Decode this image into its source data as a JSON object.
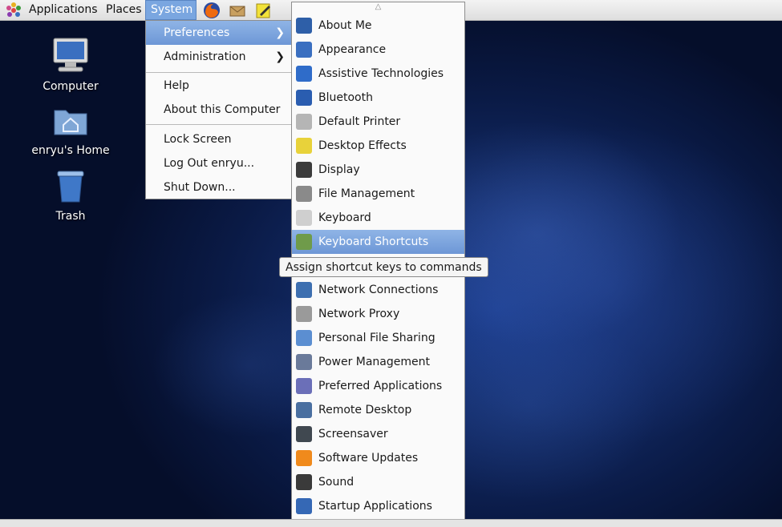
{
  "panel": {
    "applications": "Applications",
    "places": "Places",
    "system": "System",
    "launchers": [
      "firefox-icon",
      "mail-icon",
      "note-edit-icon"
    ]
  },
  "desktop_icons": [
    {
      "label": "Computer",
      "icon": "computer-icon"
    },
    {
      "label": "enryu's Home",
      "icon": "home-folder-icon"
    },
    {
      "label": "Trash",
      "icon": "trash-icon"
    }
  ],
  "system_menu": {
    "items": [
      {
        "label": "Preferences",
        "submenu": true
      },
      {
        "label": "Administration",
        "submenu": true
      },
      {
        "label": "Help"
      },
      {
        "label": "About this Computer"
      },
      {
        "label": "Lock Screen"
      },
      {
        "label": "Log Out enryu..."
      },
      {
        "label": "Shut Down..."
      }
    ],
    "highlighted": "Preferences"
  },
  "preferences_menu": {
    "items": [
      {
        "label": "About Me",
        "icon": "about-me-icon",
        "color": "#2e5fa8"
      },
      {
        "label": "Appearance",
        "icon": "appearance-icon",
        "color": "#3a6fc0"
      },
      {
        "label": "Assistive Technologies",
        "icon": "accessibility-icon",
        "color": "#2f6cc9"
      },
      {
        "label": "Bluetooth",
        "icon": "bluetooth-icon",
        "color": "#2a5db0"
      },
      {
        "label": "Default Printer",
        "icon": "printer-icon",
        "color": "#b5b5b5"
      },
      {
        "label": "Desktop Effects",
        "icon": "desktop-effects-icon",
        "color": "#e8d23a"
      },
      {
        "label": "Display",
        "icon": "display-icon",
        "color": "#3c3c3c"
      },
      {
        "label": "File Management",
        "icon": "file-management-icon",
        "color": "#8a8a8a"
      },
      {
        "label": "Keyboard",
        "icon": "keyboard-icon",
        "color": "#cfcfcf"
      },
      {
        "label": "Keyboard Shortcuts",
        "icon": "keyboard-shortcuts-icon",
        "color": "#6f9b4a"
      },
      {
        "label": "Network Connections",
        "icon": "network-connections-icon",
        "color": "#3d6fb0"
      },
      {
        "label": "Network Proxy",
        "icon": "network-proxy-icon",
        "color": "#9a9a9a"
      },
      {
        "label": "Personal File Sharing",
        "icon": "file-sharing-icon",
        "color": "#5b8ed1"
      },
      {
        "label": "Power Management",
        "icon": "power-management-icon",
        "color": "#6a7a9a"
      },
      {
        "label": "Preferred Applications",
        "icon": "preferred-apps-icon",
        "color": "#6b6fb8"
      },
      {
        "label": "Remote Desktop",
        "icon": "remote-desktop-icon",
        "color": "#4a6fa0"
      },
      {
        "label": "Screensaver",
        "icon": "screensaver-icon",
        "color": "#404850"
      },
      {
        "label": "Software Updates",
        "icon": "software-updates-icon",
        "color": "#f08a1c"
      },
      {
        "label": "Sound",
        "icon": "sound-icon",
        "color": "#3a3a3a"
      },
      {
        "label": "Startup Applications",
        "icon": "startup-apps-icon",
        "color": "#3568b5"
      }
    ],
    "highlighted": "Keyboard Shortcuts"
  },
  "tooltip": "Assign shortcut keys to commands"
}
